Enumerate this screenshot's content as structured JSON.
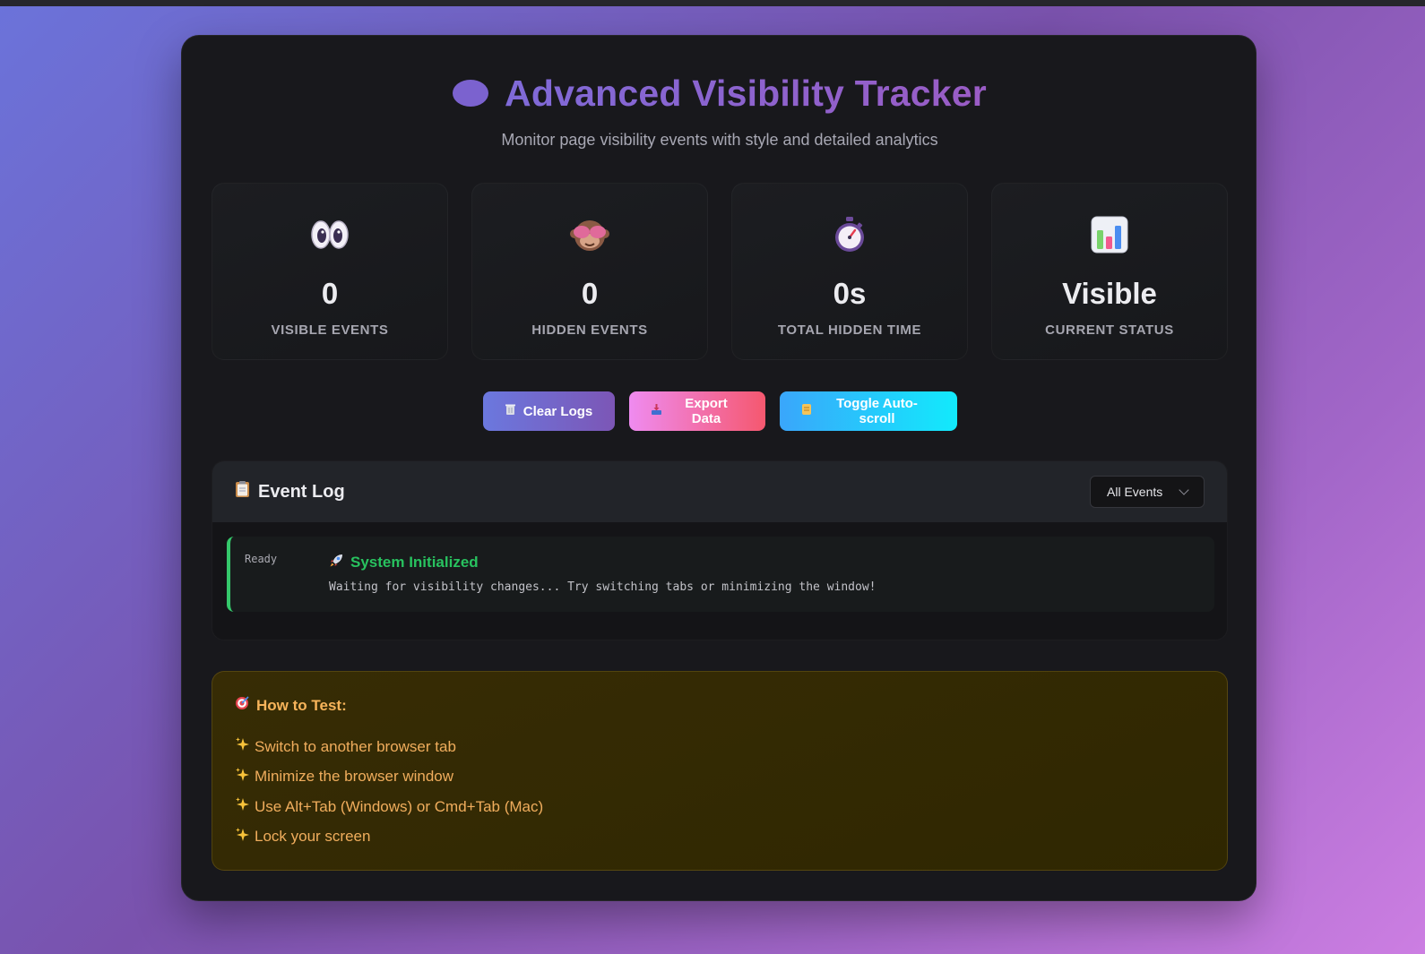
{
  "header": {
    "title": "Advanced Visibility Tracker",
    "subtitle": "Monitor page visibility events with style and detailed analytics"
  },
  "stats": [
    {
      "icon": "eyes-icon",
      "value": "0",
      "label": "VISIBLE EVENTS"
    },
    {
      "icon": "see-no-evil-monkey-icon",
      "value": "0",
      "label": "HIDDEN EVENTS"
    },
    {
      "icon": "stopwatch-icon",
      "value": "0s",
      "label": "TOTAL HIDDEN TIME"
    },
    {
      "icon": "bar-chart-icon",
      "value": "Visible",
      "label": "CURRENT STATUS"
    }
  ],
  "buttons": {
    "clear": "Clear Logs",
    "export": "Export Data",
    "autoscroll": "Toggle Auto-scroll"
  },
  "log": {
    "title": "Event Log",
    "filter_selected": "All Events",
    "entries": [
      {
        "time": "Ready",
        "event": "System Initialized",
        "message": "Waiting for visibility changes... Try switching tabs or minimizing the window!"
      }
    ]
  },
  "howto": {
    "title": "How to Test:",
    "items": [
      "Switch to another browser tab",
      "Minimize the browser window",
      "Use Alt+Tab (Windows) or Cmd+Tab (Mac)",
      "Lock your screen"
    ]
  },
  "colors": {
    "accent": "#7b62cf",
    "success": "#35c86b",
    "warning_text": "#f0ad5d"
  }
}
